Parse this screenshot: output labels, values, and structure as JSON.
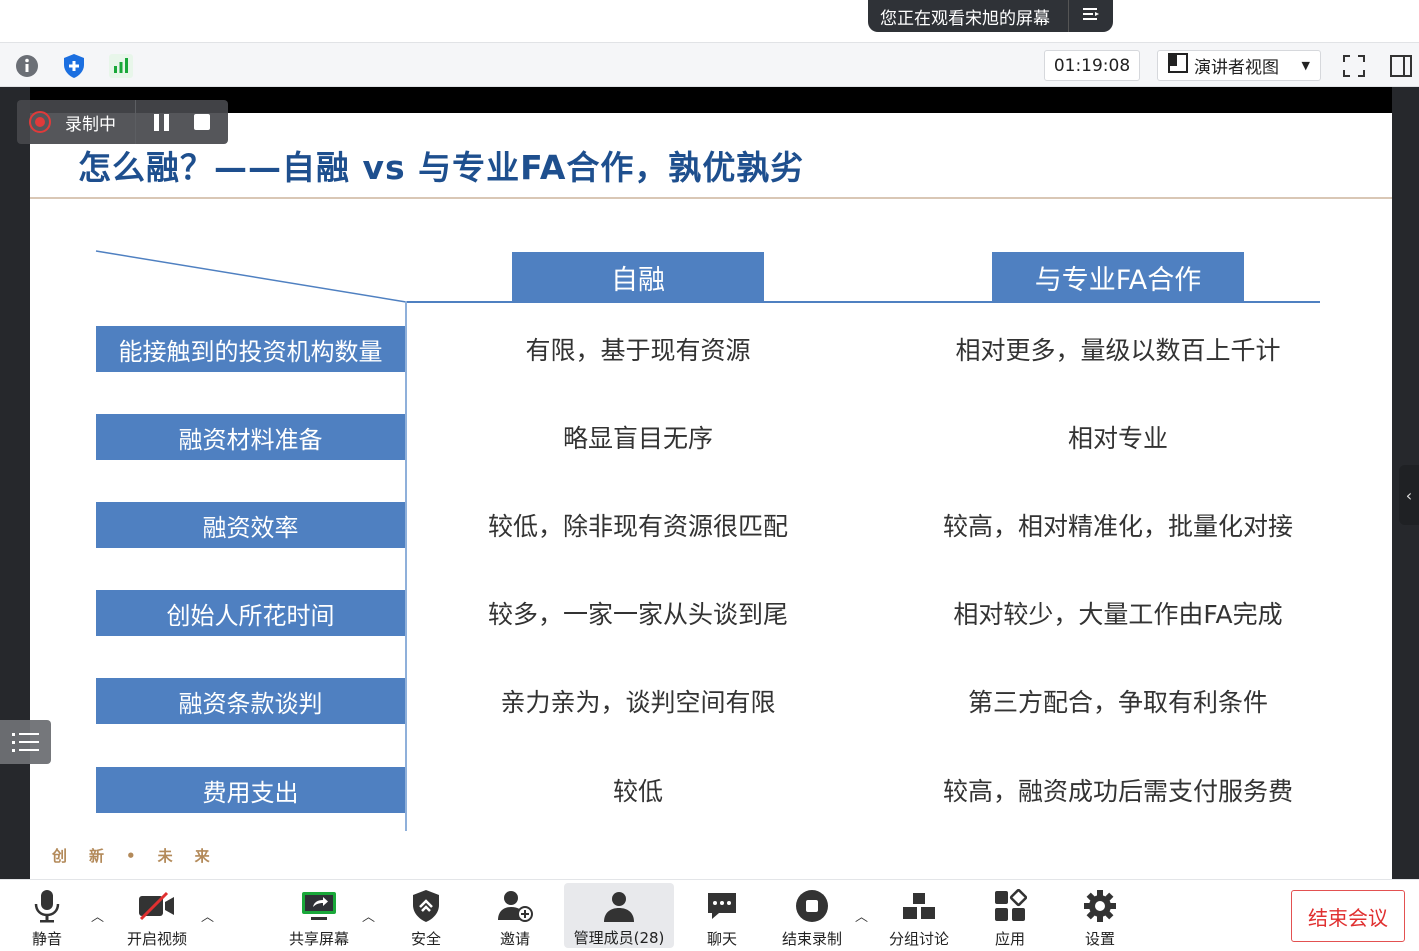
{
  "banner": {
    "watching_text": "您正在观看宋旭的屏幕",
    "menu_icon": "list-icon"
  },
  "toolbar": {
    "icons": [
      "info-icon",
      "shield-icon",
      "signal-icon",
      "fullscreen-icon",
      "side-panel-icon"
    ],
    "timer": "01:19:08",
    "view_label": "演讲者视图"
  },
  "recording": {
    "label": "录制中"
  },
  "slide": {
    "title": "怎么融？——自融 vs 与专业FA合作，孰优孰劣",
    "columns": [
      "自融",
      "与专业FA合作"
    ],
    "rows": [
      {
        "label": "能接触到的投资机构数量",
        "self": "有限，基于现有资源",
        "fa": "相对更多，量级以数百上千计"
      },
      {
        "label": "融资材料准备",
        "self": "略显盲目无序",
        "fa": "相对专业"
      },
      {
        "label": "融资效率",
        "self": "较低，除非现有资源很匹配",
        "fa": "较高，相对精准化，批量化对接"
      },
      {
        "label": "创始人所花时间",
        "self": "较多，一家一家从头谈到尾",
        "fa": "相对较少，大量工作由FA完成"
      },
      {
        "label": "融资条款谈判",
        "self": "亲力亲为，谈判空间有限",
        "fa": "第三方配合，争取有利条件"
      },
      {
        "label": "费用支出",
        "self": "较低",
        "fa": "较高，融资成功后需支付服务费"
      }
    ],
    "motto": "创新•未来"
  },
  "bottombar": {
    "items": [
      {
        "label": "静音",
        "icon": "microphone-icon"
      },
      {
        "label": "开启视频",
        "icon": "video-off-icon"
      },
      {
        "label": "共享屏幕",
        "icon": "share-screen-icon"
      },
      {
        "label": "安全",
        "icon": "security-shield-icon"
      },
      {
        "label": "邀请",
        "icon": "invite-user-icon"
      },
      {
        "label": "管理成员(28)",
        "icon": "members-icon"
      },
      {
        "label": "聊天",
        "icon": "chat-icon"
      },
      {
        "label": "结束录制",
        "icon": "stop-record-icon"
      },
      {
        "label": "分组讨论",
        "icon": "breakout-icon"
      },
      {
        "label": "应用",
        "icon": "apps-icon"
      },
      {
        "label": "设置",
        "icon": "gear-icon"
      }
    ],
    "end_label": "结束会议"
  },
  "colors": {
    "accent_blue": "#4f80c1",
    "title_blue": "#1e4f8e",
    "end_red": "#e03030",
    "rec_red": "#e03a3a"
  }
}
